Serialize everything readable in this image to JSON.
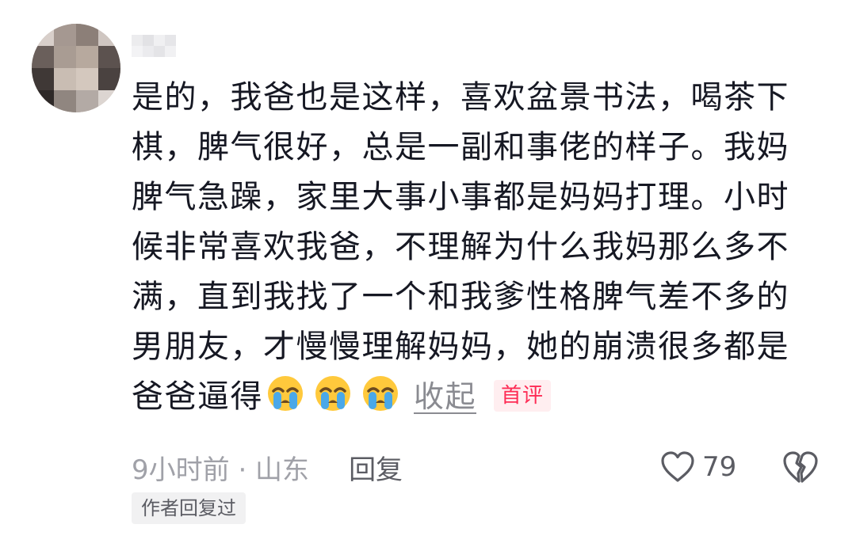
{
  "comment": {
    "lines": [
      "是的，我爸也是这样，喜欢盆景书法，喝茶下",
      "棋，脾气很好，总是一副和事佬的样子。我妈",
      "脾气急躁，家里大事小事都是妈妈打理。小时",
      "候非常喜欢我爸，不理解为什么我妈那么多不",
      "满，直到我找了一个和我爹性格脾气差不多的",
      "男朋友，才慢慢理解妈妈，她的崩溃很多都是",
      "爸爸逼得"
    ],
    "emoji_icons": [
      "crying-face-icon",
      "crying-face-icon",
      "crying-face-icon"
    ],
    "collapse_label": "收起",
    "first_badge": "首评"
  },
  "meta": {
    "time_location": "9小时前 · 山东",
    "reply_label": "回复"
  },
  "actions": {
    "like_icon": "heart-outline-icon",
    "like_count": "79",
    "dislike_icon": "broken-heart-icon"
  },
  "author_reply_tag": "作者回复过",
  "colors": {
    "text": "#161823",
    "muted": "#a0a1a8",
    "secondary": "#5b5c63",
    "badge_red": "#fe2c55",
    "badge_bg": "#ffeef0",
    "tag_bg": "#f1f1f2"
  }
}
